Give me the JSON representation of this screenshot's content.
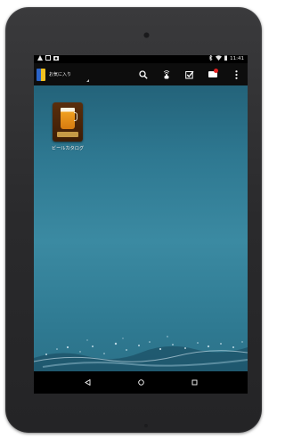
{
  "action_bar": {
    "spinner_label": "お気に入り"
  },
  "status_bar": {
    "time": "11:41"
  },
  "desktop": {
    "shortcut_label": "ビールカタログ"
  }
}
